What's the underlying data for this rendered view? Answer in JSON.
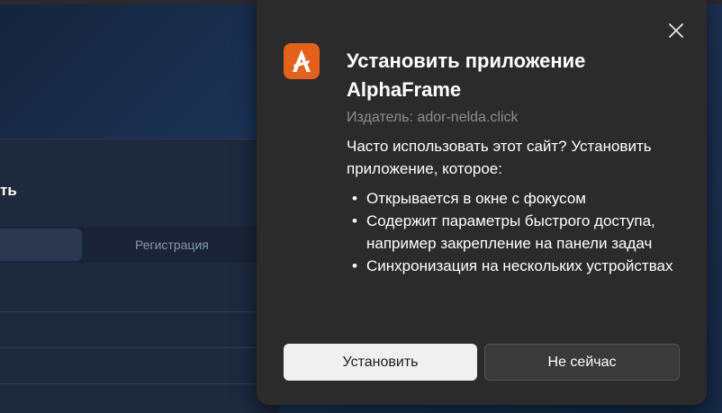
{
  "background": {
    "title_fragment": "ть",
    "tabs": {
      "register_label": "Регистрация"
    }
  },
  "dialog": {
    "title": "Установить приложение AlphaFrame",
    "publisher": "Издатель: ador-nelda.click",
    "question": "Часто использовать этот сайт? Установить приложение, которое:",
    "features": [
      "Открывается в окне с фокусом",
      "Содержит параметры быстрого доступа, например закрепление на панели задач",
      "Синхронизация на нескольких устройствах"
    ],
    "install_label": "Установить",
    "later_label": "Не сейчас",
    "app_icon": "alphaframe-logo-icon",
    "accent_color": "#e3611a"
  }
}
